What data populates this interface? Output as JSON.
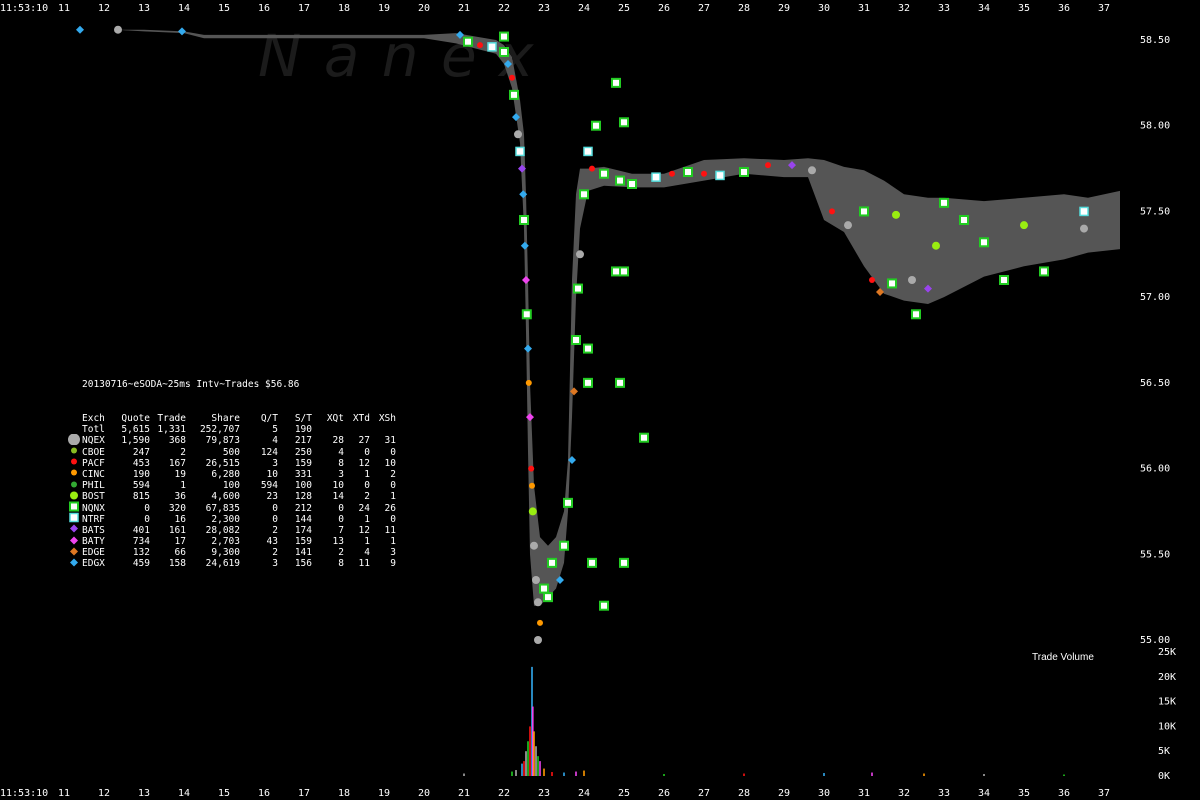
{
  "chart_data": {
    "type": "scatter",
    "title": "20130716~eSODA~25ms Intv~Trades $56.86",
    "time_label_top": "11:53:10",
    "time_label_bottom": "11:53:10",
    "watermark": "N a n e x",
    "volume_label": "Trade Volume",
    "x_ticks": [
      "11",
      "12",
      "13",
      "14",
      "15",
      "16",
      "17",
      "18",
      "19",
      "20",
      "21",
      "22",
      "23",
      "24",
      "25",
      "26",
      "27",
      "28",
      "29",
      "30",
      "31",
      "32",
      "33",
      "34",
      "35",
      "36",
      "37"
    ],
    "y_ticks": [
      "58.50",
      "58.00",
      "57.50",
      "57.00",
      "56.50",
      "56.00",
      "55.50",
      "55.00"
    ],
    "ylim": [
      55.0,
      58.5
    ],
    "volume_ticks": [
      "25K",
      "20K",
      "15K",
      "10K",
      "5K",
      "0K"
    ],
    "volume_ylim": [
      0,
      25000
    ],
    "legend": {
      "headers": [
        "Exch",
        "Quote",
        "Trade",
        "Share",
        "Q/T",
        "S/T",
        "XQt",
        "XTd",
        "XSh"
      ],
      "rows": [
        {
          "exch": "Totl",
          "quote": "5,615",
          "trade": "1,331",
          "share": "252,707",
          "qt": "5",
          "st": "190",
          "xqt": "",
          "xtd": "",
          "xsh": "",
          "color": "",
          "shape": "none"
        },
        {
          "exch": "NQEX",
          "quote": "1,590",
          "trade": "368",
          "share": "79,873",
          "qt": "4",
          "st": "217",
          "xqt": "28",
          "xtd": "27",
          "xsh": "31",
          "color": "#aaaaaa",
          "shape": "circle"
        },
        {
          "exch": "CBOE",
          "quote": "247",
          "trade": "2",
          "share": "500",
          "qt": "124",
          "st": "250",
          "xqt": "4",
          "xtd": "0",
          "xsh": "0",
          "color": "#88bb22",
          "shape": "dot"
        },
        {
          "exch": "PACF",
          "quote": "453",
          "trade": "167",
          "share": "26,515",
          "qt": "3",
          "st": "159",
          "xqt": "8",
          "xtd": "12",
          "xsh": "10",
          "color": "#ff1111",
          "shape": "dot"
        },
        {
          "exch": "CINC",
          "quote": "190",
          "trade": "19",
          "share": "6,280",
          "qt": "10",
          "st": "331",
          "xqt": "3",
          "xtd": "1",
          "xsh": "2",
          "color": "#ff9900",
          "shape": "dot"
        },
        {
          "exch": "PHIL",
          "quote": "594",
          "trade": "1",
          "share": "100",
          "qt": "594",
          "st": "100",
          "xqt": "10",
          "xtd": "0",
          "xsh": "0",
          "color": "#33aa33",
          "shape": "dot"
        },
        {
          "exch": "BOST",
          "quote": "815",
          "trade": "36",
          "share": "4,600",
          "qt": "23",
          "st": "128",
          "xqt": "14",
          "xtd": "2",
          "xsh": "1",
          "color": "#99ee11",
          "shape": "circle"
        },
        {
          "exch": "NQNX",
          "quote": "0",
          "trade": "320",
          "share": "67,835",
          "qt": "0",
          "st": "212",
          "xqt": "0",
          "xtd": "24",
          "xsh": "26",
          "color": "#22cc22",
          "shape": "square"
        },
        {
          "exch": "NTRF",
          "quote": "0",
          "trade": "16",
          "share": "2,300",
          "qt": "0",
          "st": "144",
          "xqt": "0",
          "xtd": "1",
          "xsh": "0",
          "color": "#55dddd",
          "shape": "square"
        },
        {
          "exch": "BATS",
          "quote": "401",
          "trade": "161",
          "share": "28,082",
          "qt": "2",
          "st": "174",
          "xqt": "7",
          "xtd": "12",
          "xsh": "11",
          "color": "#9944ee",
          "shape": "diamond"
        },
        {
          "exch": "BATY",
          "quote": "734",
          "trade": "17",
          "share": "2,703",
          "qt": "43",
          "st": "159",
          "xqt": "13",
          "xtd": "1",
          "xsh": "1",
          "color": "#ee44ee",
          "shape": "diamond"
        },
        {
          "exch": "EDGE",
          "quote": "132",
          "trade": "66",
          "share": "9,300",
          "qt": "2",
          "st": "141",
          "xqt": "2",
          "xtd": "4",
          "xsh": "3",
          "color": "#dd7722",
          "shape": "diamond"
        },
        {
          "exch": "EDGX",
          "quote": "459",
          "trade": "158",
          "share": "24,619",
          "qt": "3",
          "st": "156",
          "xqt": "8",
          "xtd": "11",
          "xsh": "9",
          "color": "#33aaee",
          "shape": "diamond"
        }
      ]
    },
    "nbbo_band": [
      [
        11.0,
        58.57,
        58.57
      ],
      [
        11.4,
        58.56,
        58.56
      ],
      [
        12.3,
        58.56,
        58.56
      ],
      [
        13.0,
        58.55,
        58.56
      ],
      [
        14.0,
        58.54,
        58.55
      ],
      [
        14.5,
        58.51,
        58.53
      ],
      [
        20.0,
        58.51,
        58.53
      ],
      [
        20.8,
        58.48,
        58.54
      ],
      [
        21.3,
        58.45,
        58.52
      ],
      [
        21.8,
        58.42,
        58.5
      ],
      [
        22.0,
        58.36,
        58.47
      ],
      [
        22.2,
        58.22,
        58.4
      ],
      [
        22.4,
        57.9,
        58.15
      ],
      [
        22.5,
        57.4,
        57.95
      ],
      [
        22.55,
        56.8,
        57.6
      ],
      [
        22.6,
        56.1,
        57.1
      ],
      [
        22.65,
        55.5,
        56.5
      ],
      [
        22.75,
        55.2,
        55.9
      ],
      [
        22.9,
        55.2,
        55.6
      ],
      [
        23.1,
        55.25,
        55.55
      ],
      [
        23.3,
        55.3,
        55.6
      ],
      [
        23.5,
        55.45,
        55.75
      ],
      [
        23.6,
        55.75,
        56.05
      ],
      [
        23.7,
        56.3,
        57.1
      ],
      [
        23.8,
        57.0,
        57.6
      ],
      [
        23.9,
        57.4,
        57.75
      ],
      [
        24.1,
        57.62,
        57.75
      ],
      [
        24.5,
        57.65,
        57.76
      ],
      [
        25.2,
        57.64,
        57.72
      ],
      [
        26.0,
        57.64,
        57.72
      ],
      [
        27.0,
        57.68,
        57.8
      ],
      [
        28.0,
        57.72,
        57.81
      ],
      [
        29.0,
        57.7,
        57.8
      ],
      [
        29.6,
        57.7,
        57.81
      ],
      [
        30.0,
        57.45,
        57.8
      ],
      [
        30.5,
        57.38,
        57.76
      ],
      [
        31.0,
        57.18,
        57.74
      ],
      [
        31.5,
        57.02,
        57.68
      ],
      [
        32.0,
        56.98,
        57.6
      ],
      [
        32.6,
        56.96,
        57.58
      ],
      [
        33.0,
        57.0,
        57.58
      ],
      [
        34.0,
        57.12,
        57.56
      ],
      [
        35.0,
        57.18,
        57.58
      ],
      [
        36.0,
        57.22,
        57.6
      ],
      [
        36.6,
        57.26,
        57.58
      ],
      [
        37.4,
        57.28,
        57.62
      ]
    ],
    "trades": [
      {
        "t": 11.4,
        "p": 58.56,
        "e": "EDGX"
      },
      {
        "t": 12.35,
        "p": 58.56,
        "e": "NQEX"
      },
      {
        "t": 13.95,
        "p": 58.55,
        "e": "EDGX"
      },
      {
        "t": 20.9,
        "p": 58.53,
        "e": "EDGX"
      },
      {
        "t": 21.1,
        "p": 58.49,
        "e": "NQNX"
      },
      {
        "t": 21.4,
        "p": 58.47,
        "e": "PACF"
      },
      {
        "t": 21.7,
        "p": 58.46,
        "e": "NTRF"
      },
      {
        "t": 22.0,
        "p": 58.52,
        "e": "NQNX"
      },
      {
        "t": 22.0,
        "p": 58.43,
        "e": "NQNX"
      },
      {
        "t": 22.1,
        "p": 58.36,
        "e": "EDGX"
      },
      {
        "t": 22.2,
        "p": 58.28,
        "e": "PACF"
      },
      {
        "t": 22.25,
        "p": 58.18,
        "e": "NQNX"
      },
      {
        "t": 22.3,
        "p": 58.05,
        "e": "EDGX"
      },
      {
        "t": 22.35,
        "p": 57.95,
        "e": "NQEX"
      },
      {
        "t": 22.4,
        "p": 57.85,
        "e": "NTRF"
      },
      {
        "t": 22.45,
        "p": 57.75,
        "e": "BATS"
      },
      {
        "t": 22.48,
        "p": 57.6,
        "e": "EDGX"
      },
      {
        "t": 22.5,
        "p": 57.45,
        "e": "NQNX"
      },
      {
        "t": 22.52,
        "p": 57.3,
        "e": "EDGX"
      },
      {
        "t": 22.55,
        "p": 57.1,
        "e": "BATY"
      },
      {
        "t": 22.57,
        "p": 56.9,
        "e": "NQNX"
      },
      {
        "t": 22.6,
        "p": 56.7,
        "e": "EDGX"
      },
      {
        "t": 22.62,
        "p": 56.5,
        "e": "CINC"
      },
      {
        "t": 22.65,
        "p": 56.3,
        "e": "BATY"
      },
      {
        "t": 22.68,
        "p": 56.0,
        "e": "PACF"
      },
      {
        "t": 22.7,
        "p": 55.9,
        "e": "CINC"
      },
      {
        "t": 22.72,
        "p": 55.75,
        "e": "BOST"
      },
      {
        "t": 22.75,
        "p": 55.55,
        "e": "NQEX"
      },
      {
        "t": 22.8,
        "p": 55.35,
        "e": "NQEX"
      },
      {
        "t": 22.85,
        "p": 55.22,
        "e": "NQEX"
      },
      {
        "t": 22.9,
        "p": 55.1,
        "e": "CINC"
      },
      {
        "t": 22.85,
        "p": 55.0,
        "e": "NQEX"
      },
      {
        "t": 23.0,
        "p": 55.3,
        "e": "NQNX"
      },
      {
        "t": 23.1,
        "p": 55.25,
        "e": "NQNX"
      },
      {
        "t": 23.2,
        "p": 55.45,
        "e": "NQNX"
      },
      {
        "t": 23.4,
        "p": 55.35,
        "e": "EDGX"
      },
      {
        "t": 23.5,
        "p": 55.55,
        "e": "NQNX"
      },
      {
        "t": 23.6,
        "p": 55.8,
        "e": "NQNX"
      },
      {
        "t": 23.7,
        "p": 56.05,
        "e": "EDGX"
      },
      {
        "t": 23.75,
        "p": 56.45,
        "e": "EDGE"
      },
      {
        "t": 23.8,
        "p": 56.75,
        "e": "NQNX"
      },
      {
        "t": 23.85,
        "p": 57.05,
        "e": "NQNX"
      },
      {
        "t": 23.9,
        "p": 57.25,
        "e": "NQEX"
      },
      {
        "t": 24.0,
        "p": 57.6,
        "e": "NQNX"
      },
      {
        "t": 24.1,
        "p": 57.85,
        "e": "NTRF"
      },
      {
        "t": 24.3,
        "p": 58.0,
        "e": "NQNX"
      },
      {
        "t": 24.2,
        "p": 57.75,
        "e": "PACF"
      },
      {
        "t": 24.5,
        "p": 57.72,
        "e": "NQNX"
      },
      {
        "t": 24.9,
        "p": 57.68,
        "e": "NQNX"
      },
      {
        "t": 25.2,
        "p": 57.66,
        "e": "NQNX"
      },
      {
        "t": 25.8,
        "p": 57.7,
        "e": "NTRF"
      },
      {
        "t": 26.2,
        "p": 57.72,
        "e": "PACF"
      },
      {
        "t": 26.6,
        "p": 57.73,
        "e": "NQNX"
      },
      {
        "t": 27.0,
        "p": 57.72,
        "e": "PACF"
      },
      {
        "t": 27.4,
        "p": 57.71,
        "e": "NTRF"
      },
      {
        "t": 28.0,
        "p": 57.73,
        "e": "NQNX"
      },
      {
        "t": 28.6,
        "p": 57.77,
        "e": "PACF"
      },
      {
        "t": 29.2,
        "p": 57.77,
        "e": "BATS"
      },
      {
        "t": 29.7,
        "p": 57.74,
        "e": "NQEX"
      },
      {
        "t": 30.2,
        "p": 57.5,
        "e": "PACF"
      },
      {
        "t": 30.6,
        "p": 57.42,
        "e": "NQEX"
      },
      {
        "t": 31.0,
        "p": 57.5,
        "e": "NQNX"
      },
      {
        "t": 31.2,
        "p": 57.1,
        "e": "PACF"
      },
      {
        "t": 31.4,
        "p": 57.03,
        "e": "EDGE"
      },
      {
        "t": 31.7,
        "p": 57.08,
        "e": "NQNX"
      },
      {
        "t": 32.2,
        "p": 57.1,
        "e": "NQEX"
      },
      {
        "t": 32.6,
        "p": 57.05,
        "e": "BATS"
      },
      {
        "t": 32.3,
        "p": 56.9,
        "e": "NQNX"
      },
      {
        "t": 32.8,
        "p": 57.3,
        "e": "BOST"
      },
      {
        "t": 33.0,
        "p": 57.55,
        "e": "NQNX"
      },
      {
        "t": 33.5,
        "p": 57.45,
        "e": "NQNX"
      },
      {
        "t": 34.0,
        "p": 57.32,
        "e": "NQNX"
      },
      {
        "t": 34.5,
        "p": 57.1,
        "e": "NQNX"
      },
      {
        "t": 35.0,
        "p": 57.42,
        "e": "BOST"
      },
      {
        "t": 35.5,
        "p": 57.15,
        "e": "NQNX"
      },
      {
        "t": 36.5,
        "p": 57.5,
        "e": "NTRF"
      },
      {
        "t": 36.5,
        "p": 57.4,
        "e": "NQEX"
      },
      {
        "t": 31.8,
        "p": 57.48,
        "e": "BOST"
      },
      {
        "t": 24.8,
        "p": 58.25,
        "e": "NQNX"
      },
      {
        "t": 25.0,
        "p": 58.02,
        "e": "NQNX"
      },
      {
        "t": 24.8,
        "p": 57.15,
        "e": "NQNX"
      },
      {
        "t": 25.0,
        "p": 57.15,
        "e": "NQNX"
      },
      {
        "t": 24.1,
        "p": 56.5,
        "e": "NQNX"
      },
      {
        "t": 24.9,
        "p": 56.5,
        "e": "NQNX"
      },
      {
        "t": 25.5,
        "p": 56.18,
        "e": "NQNX"
      },
      {
        "t": 24.2,
        "p": 55.45,
        "e": "NQNX"
      },
      {
        "t": 25.0,
        "p": 55.45,
        "e": "NQNX"
      },
      {
        "t": 24.5,
        "p": 55.2,
        "e": "NQNX"
      },
      {
        "t": 24.1,
        "p": 56.7,
        "e": "NQNX"
      }
    ],
    "volume": [
      {
        "t": 22.55,
        "v": 5000
      },
      {
        "t": 22.6,
        "v": 7000
      },
      {
        "t": 22.65,
        "v": 10000
      },
      {
        "t": 22.7,
        "v": 22000
      },
      {
        "t": 22.72,
        "v": 14000
      },
      {
        "t": 22.75,
        "v": 9000
      },
      {
        "t": 22.8,
        "v": 6000
      },
      {
        "t": 22.85,
        "v": 4000
      },
      {
        "t": 22.5,
        "v": 3000
      },
      {
        "t": 22.45,
        "v": 2500
      },
      {
        "t": 22.9,
        "v": 3000
      },
      {
        "t": 23.0,
        "v": 1500
      },
      {
        "t": 22.3,
        "v": 1200
      },
      {
        "t": 22.2,
        "v": 900
      },
      {
        "t": 23.2,
        "v": 800
      },
      {
        "t": 23.5,
        "v": 700
      },
      {
        "t": 23.8,
        "v": 900
      },
      {
        "t": 24.0,
        "v": 1100
      },
      {
        "t": 21.0,
        "v": 500
      },
      {
        "t": 26.0,
        "v": 400
      },
      {
        "t": 28.0,
        "v": 500
      },
      {
        "t": 30.0,
        "v": 600
      },
      {
        "t": 31.2,
        "v": 700
      },
      {
        "t": 32.5,
        "v": 500
      },
      {
        "t": 34.0,
        "v": 400
      },
      {
        "t": 36.0,
        "v": 300
      }
    ]
  }
}
